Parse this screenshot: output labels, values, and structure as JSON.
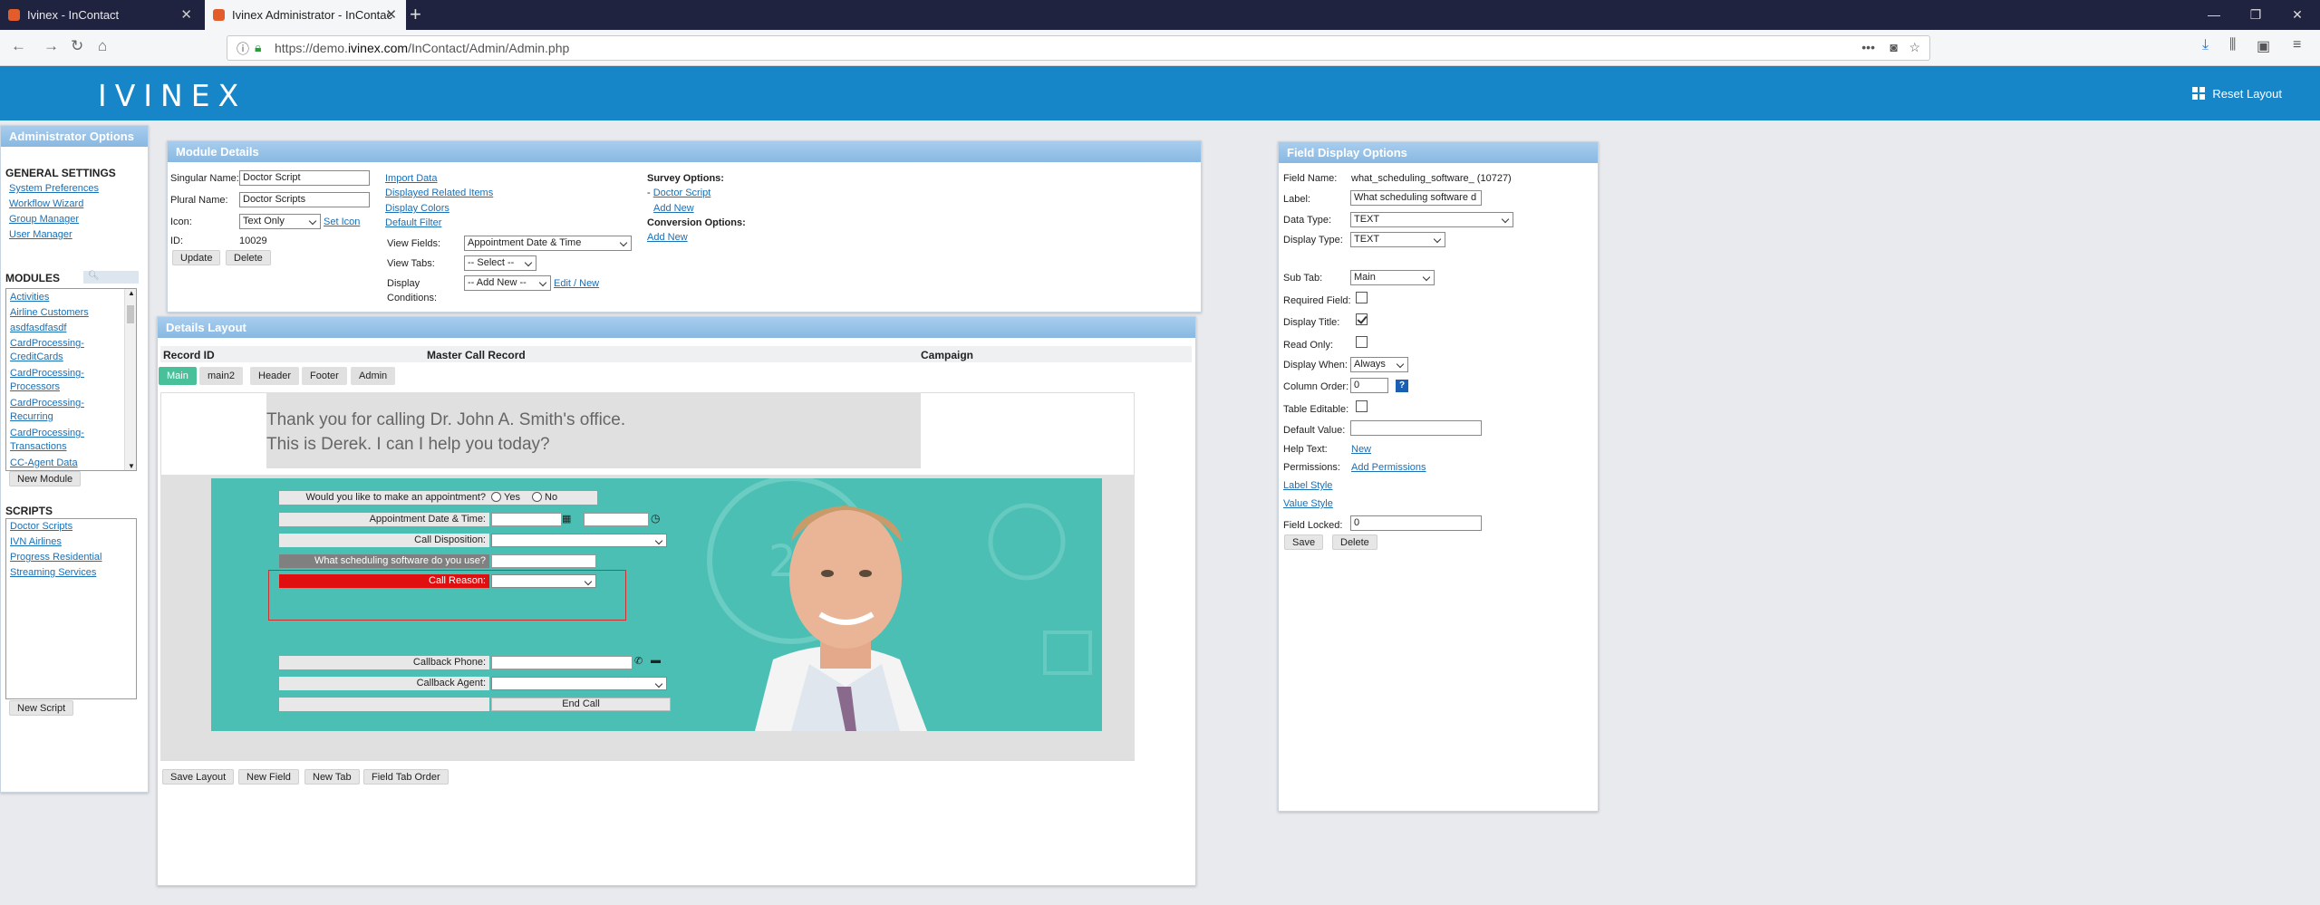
{
  "browser": {
    "tabs": [
      {
        "title": "Ivinex - InContact"
      },
      {
        "title": "Ivinex Administrator - InContac"
      }
    ],
    "url_prefix": "https://demo.",
    "url_domain": "ivinex.com",
    "url_path": "/InContact/Admin/Admin.php"
  },
  "header": {
    "logo": "IVINEX",
    "reset_layout": "Reset Layout"
  },
  "admin_options": {
    "title": "Administrator Options",
    "general_heading": "GENERAL SETTINGS",
    "general_links": [
      "System Preferences",
      "Workflow Wizard",
      "Group Manager",
      "User Manager"
    ],
    "modules_heading": "MODULES",
    "modules": [
      "Activities",
      "Airline Customers",
      "asdfasdfasdf",
      "CardProcessing-",
      "CreditCards",
      "CardProcessing-",
      "Processors",
      "CardProcessing-",
      "Recurring",
      "CardProcessing-",
      "Transactions",
      "CC-Agent Data"
    ],
    "new_module": "New Module",
    "scripts_heading": "SCRIPTS",
    "scripts": [
      "Doctor Scripts",
      "IVN Airlines",
      "Progress Residential",
      "Streaming Services"
    ],
    "new_script": "New Script"
  },
  "module_details": {
    "title": "Module Details",
    "singular_label": "Singular Name:",
    "singular_value": "Doctor Script",
    "plural_label": "Plural Name:",
    "plural_value": "Doctor Scripts",
    "icon_label": "Icon:",
    "icon_value": "Text Only",
    "set_icon": "Set Icon",
    "id_label": "ID:",
    "id_value": "10029",
    "update": "Update",
    "delete": "Delete",
    "links": [
      "Import Data",
      "Displayed Related Items",
      "Display Colors",
      "Default Filter"
    ],
    "view_fields_label": "View Fields:",
    "view_fields_value": "Appointment Date & Time",
    "view_tabs_label": "View Tabs:",
    "view_tabs_value": "-- Select --",
    "display_label": "Display",
    "conditions_label": "Conditions:",
    "display_value": "-- Add New --",
    "edit_new": "Edit / New",
    "survey_heading": "Survey Options:",
    "survey_prefix": "- ",
    "survey_link": "Doctor Script",
    "survey_add": "Add New",
    "conversion_heading": "Conversion Options:",
    "conversion_add": "Add New"
  },
  "details_layout": {
    "title": "Details Layout",
    "columns": [
      "Record ID",
      "Master Call Record",
      "Campaign"
    ],
    "tabs": [
      "Main",
      "main2",
      "Header",
      "Footer",
      "Admin"
    ],
    "greeting_line1": "Thank you for calling Dr. John A. Smith's office.",
    "greeting_line2": "This is Derek.  I can I help you today?",
    "fields": {
      "appointment_q": "Would you like to make an appointment?",
      "yes": "Yes",
      "no": "No",
      "appt_datetime": "Appointment Date & Time:",
      "call_disposition": "Call Disposition:",
      "scheduling": "What scheduling software do you use?",
      "call_reason": "Call Reason:",
      "callback_phone": "Callback Phone:",
      "callback_agent": "Callback Agent:",
      "end_call": "End Call"
    },
    "buttons": [
      "Save Layout",
      "New Field",
      "New Tab",
      "Field Tab Order"
    ]
  },
  "field_display": {
    "title": "Field Display Options",
    "field_name_label": "Field Name:",
    "field_name_value": "what_scheduling_software_ (10727)",
    "label_label": "Label:",
    "label_value": "What scheduling software d",
    "data_type_label": "Data Type:",
    "data_type_value": "TEXT",
    "display_type_label": "Display Type:",
    "display_type_value": "TEXT",
    "sub_tab_label": "Sub Tab:",
    "sub_tab_value": "Main",
    "required_label": "Required Field:",
    "display_title_label": "Display Title:",
    "read_only_label": "Read Only:",
    "display_when_label": "Display When:",
    "display_when_value": "Always",
    "column_order_label": "Column Order:",
    "column_order_value": "0",
    "help_mark": "?",
    "table_editable_label": "Table Editable:",
    "default_value_label": "Default Value:",
    "help_text_label": "Help Text:",
    "help_text_link": "New",
    "permissions_label": "Permissions:",
    "permissions_link": "Add Permissions",
    "label_style": "Label Style",
    "value_style": "Value Style",
    "field_locked_label": "Field Locked:",
    "field_locked_value": "0",
    "save": "Save",
    "delete": "Delete"
  },
  "colors": {
    "brand": "#1686c9",
    "teal": "#4cbfb4",
    "active_tab": "#48c19a",
    "call_reason": "#e01010"
  }
}
